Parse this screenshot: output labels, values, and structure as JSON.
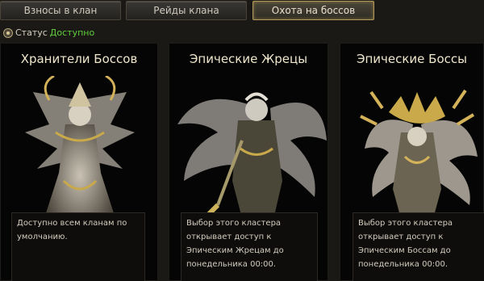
{
  "tabs": [
    {
      "label": "Взносы в клан",
      "active": false
    },
    {
      "label": "Рейды клана",
      "active": false
    },
    {
      "label": "Охота на боссов",
      "active": true
    }
  ],
  "status": {
    "label": "Статус",
    "value": "Доступно",
    "value_color": "#5fcf3b"
  },
  "cards": [
    {
      "title": "Хранители Боссов",
      "description": "Доступно всем кланам по умолчанию.",
      "art_icon": "boss-guardian-icon"
    },
    {
      "title": "Эпические Жрецы",
      "description": "Выбор этого кластера открывает доступ к Эпическим Жрецам до понедельника 00:00.",
      "art_icon": "epic-priest-icon"
    },
    {
      "title": "Эпические Боссы",
      "description": "Выбор этого кластера открывает доступ к Эпическим Боссам до понедельника 00:00.",
      "art_icon": "epic-boss-icon"
    }
  ],
  "colors": {
    "accent": "#b49a5c",
    "background": "#1b1916",
    "panel": "#050505"
  }
}
